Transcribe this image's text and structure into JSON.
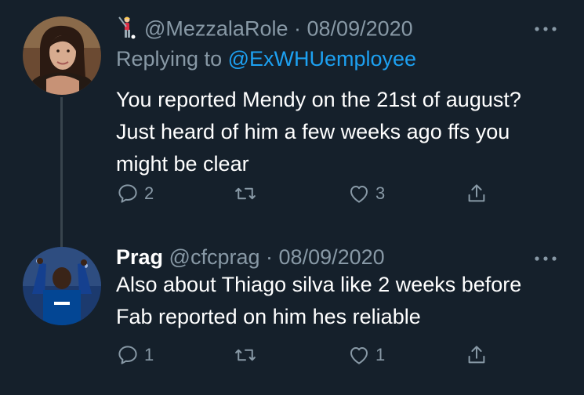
{
  "tweets": [
    {
      "handle": "@MezzalaRole",
      "separator": "·",
      "date": "08/09/2020",
      "replying_label": "Replying to",
      "replying_handle": "@ExWHUemployee",
      "text": "You reported Mendy on the 21st of august? Just heard of him a few weeks ago ffs you might be clear",
      "reply_count": "2",
      "retweet_count": "",
      "like_count": "3"
    },
    {
      "display_name": "Prag",
      "handle": "@cfcprag",
      "separator": "·",
      "date": "08/09/2020",
      "text": "Also about Thiago silva like 2 weeks before Fab reported on him hes reliable",
      "reply_count": "1",
      "retweet_count": "",
      "like_count": "1"
    }
  ],
  "icons": {
    "more": "more-dots-icon",
    "reply": "reply-bubble-icon",
    "retweet": "retweet-icon",
    "like": "heart-icon",
    "share": "share-icon",
    "emoji": "golfer-emoji-icon"
  },
  "colors": {
    "background": "#15202b",
    "text": "#ffffff",
    "muted": "#8899a6",
    "link": "#1da1f2",
    "thread_line": "#38444d"
  }
}
